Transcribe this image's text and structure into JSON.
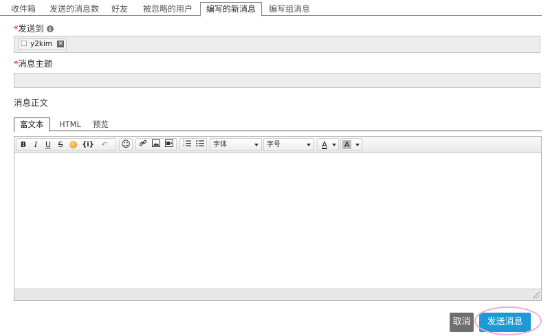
{
  "top_tabs": [
    {
      "label": "收件箱"
    },
    {
      "label": "发送的消息数"
    },
    {
      "label": "好友"
    },
    {
      "label": "被忽略的用户"
    },
    {
      "label": "编写的新消息",
      "active": true
    },
    {
      "label": "编写组消息"
    }
  ],
  "form": {
    "required_mark": "*",
    "recipients_label": "发送到",
    "recipients_info_icon": "i",
    "recipients": [
      {
        "name": "y2kim"
      }
    ],
    "remove_icon": "✕",
    "subject_label": "消息主题",
    "subject_value": "",
    "body_label": "消息正文"
  },
  "editor_tabs": [
    {
      "label": "富文本",
      "active": true
    },
    {
      "label": "HTML"
    },
    {
      "label": "预览"
    }
  ],
  "toolbar": {
    "bold": "B",
    "italic": "I",
    "underline": "U",
    "strike": "S",
    "code": "{i}",
    "undo": "↶",
    "emoji": "☺",
    "link": "🔗",
    "font_label": "字体",
    "size_label": "字号",
    "text_color_label": "A",
    "bg_color_label": "A"
  },
  "buttons": {
    "cancel": "取消",
    "send": "发送消息"
  },
  "colors": {
    "send_button": "#1d9ad6",
    "cancel_button": "#6f6f6f",
    "required": "#dd0000",
    "highlight": "#f0a8d8"
  }
}
